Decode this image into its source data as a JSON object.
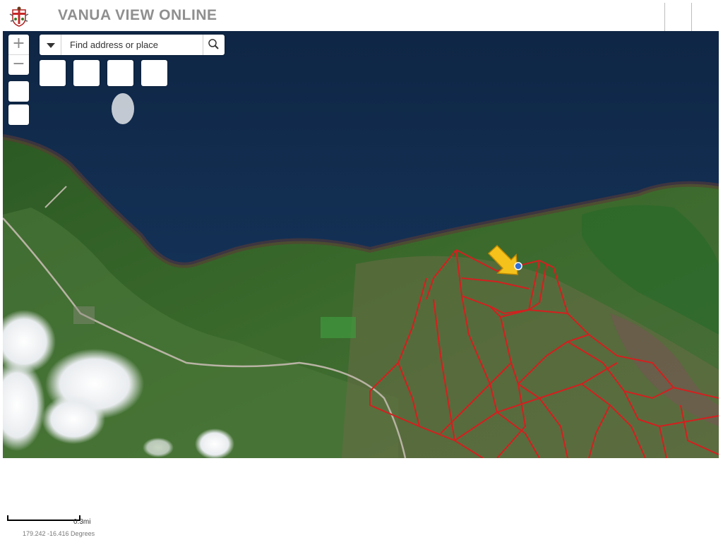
{
  "header": {
    "title": "VANUA VIEW ONLINE"
  },
  "search": {
    "placeholder": "Find address or place",
    "value": ""
  },
  "zoom": {
    "in_label": "+",
    "out_label": "−"
  },
  "scale": {
    "label": "0.3mi"
  },
  "coordinates": {
    "text": "179.242 -16.416 Degrees"
  },
  "map": {
    "basemap": "satellite-imagery",
    "marker_icon": "yellow-arrow-pointer",
    "parcel_color": "#d41f1f"
  },
  "icons": [
    "coat-of-arms-logo",
    "search-icon",
    "dropdown-caret-icon",
    "zoom-in-icon",
    "zoom-out-icon"
  ]
}
